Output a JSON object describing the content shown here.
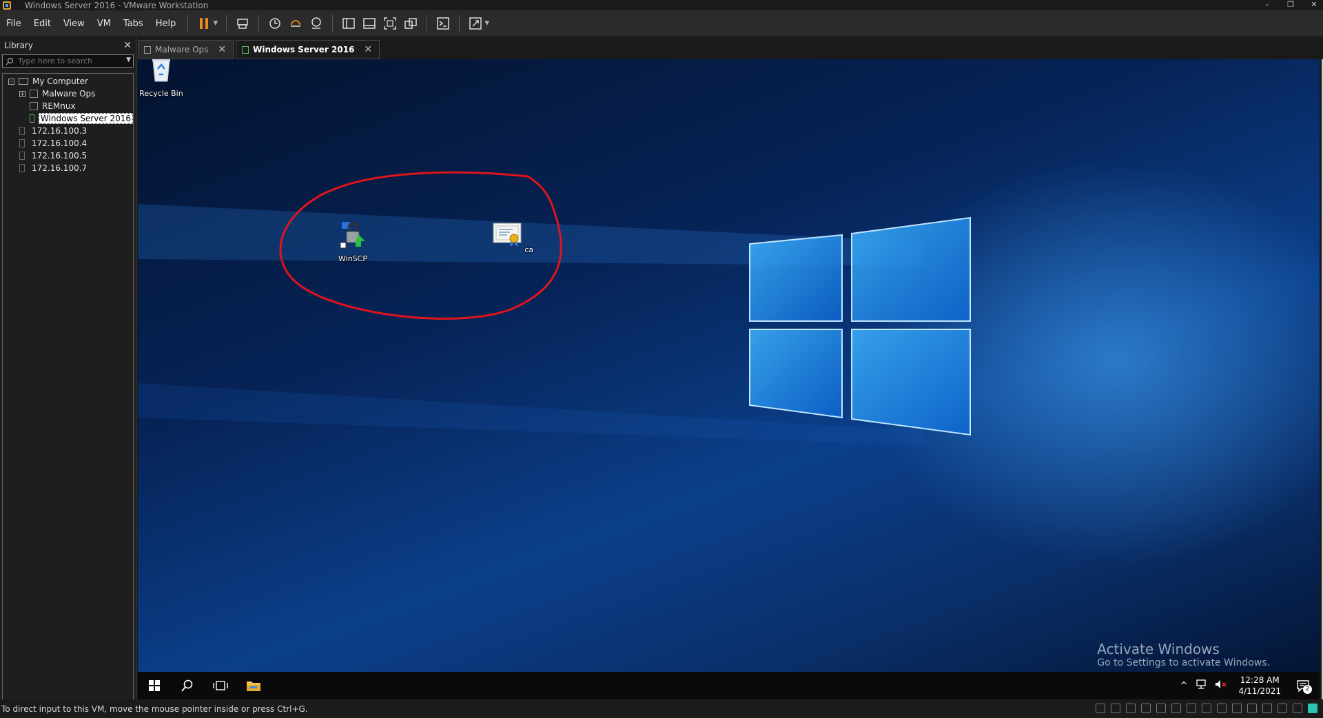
{
  "window": {
    "title": "Windows Server 2016 - VMware Workstation",
    "controls": [
      "–",
      "❐",
      "✕"
    ]
  },
  "menu": [
    "File",
    "Edit",
    "View",
    "VM",
    "Tabs",
    "Help"
  ],
  "toolbar": {
    "icons": [
      "pause-icon",
      "send-ctrl-alt-del-icon",
      "snapshot-icon",
      "revert-snapshot-icon",
      "snapshot-manager-icon",
      "show-library-icon",
      "thumbnail-bar-icon",
      "full-screen-icon",
      "unity-icon",
      "console-view-icon",
      "stretch-guest-icon"
    ]
  },
  "library": {
    "title": "Library",
    "close": "✕",
    "search_placeholder": "Type here to search",
    "tree": [
      {
        "label": "My Computer",
        "level": 0,
        "type": "computer",
        "toggle": "–"
      },
      {
        "label": "Malware Ops",
        "level": 1,
        "type": "vm",
        "toggle": "+"
      },
      {
        "label": "REMnux",
        "level": 1,
        "type": "vm"
      },
      {
        "label": "Windows Server 2016",
        "level": 1,
        "type": "vm",
        "selected": true
      },
      {
        "label": "172.16.100.3",
        "level": 1,
        "type": "host"
      },
      {
        "label": "172.16.100.4",
        "level": 1,
        "type": "host"
      },
      {
        "label": "172.16.100.5",
        "level": 1,
        "type": "host"
      },
      {
        "label": "172.16.100.7",
        "level": 1,
        "type": "host"
      }
    ]
  },
  "tabs": [
    {
      "label": "Malware Ops",
      "active": false,
      "close": "✕"
    },
    {
      "label": "Windows Server 2016",
      "active": true,
      "close": "✕"
    }
  ],
  "desktop": {
    "icons": [
      {
        "label": "Recycle Bin",
        "icon": "recycle-bin-icon"
      },
      {
        "label": "WinSCP",
        "icon": "winscp-icon"
      },
      {
        "label": "ca",
        "icon": "certificate-icon"
      }
    ],
    "activation": {
      "title": "Activate Windows",
      "subtitle": "Go to Settings to activate Windows."
    },
    "annotation_color": "#e0141c"
  },
  "taskbar": {
    "tray_chevron": "^",
    "time": "12:28 AM",
    "date": "4/11/2021",
    "notification_count": "2"
  },
  "statusbar": {
    "message": "To direct input to this VM, move the mouse pointer inside or press Ctrl+G."
  },
  "colors": {
    "accent_orange": "#e8891e",
    "wallpaper_blue": "#0b3f8a",
    "status_teal": "#2cc6b0"
  }
}
